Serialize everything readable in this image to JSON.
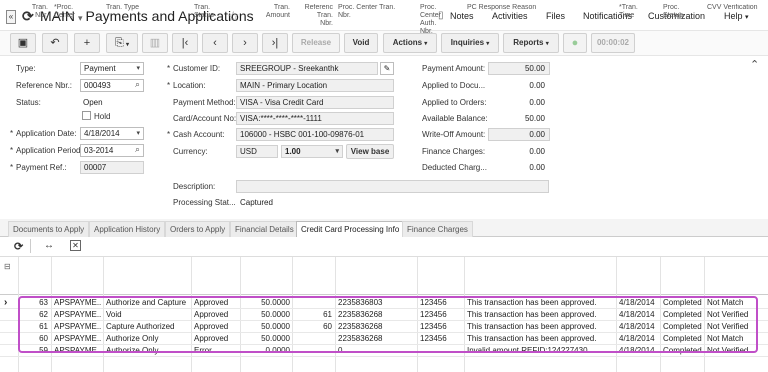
{
  "title": {
    "collapse": "«",
    "company": "MAIN",
    "sep": "▾",
    "screen": "Payments and Applications",
    "star": "☆"
  },
  "top_links": [
    "Notes",
    "Activities",
    "Files",
    "Notifications",
    "Customization",
    "Help"
  ],
  "toolbar": {
    "release": "Release",
    "void": "Void",
    "actions": "Actions",
    "inquiries": "Inquiries",
    "reports": "Reports",
    "timer": "00:00:02"
  },
  "form": {
    "type_label": "Type:",
    "type_value": "Payment",
    "refnbr_label": "Reference Nbr.:",
    "refnbr_value": "000493",
    "status_label": "Status:",
    "status_value": "Open",
    "hold_label": "Hold",
    "appdate_label": "Application Date:",
    "appdate_value": "4/18/2014",
    "appperiod_label": "Application Period:",
    "appperiod_value": "03-2014",
    "payref_label": "Payment Ref.:",
    "payref_value": "00007",
    "customer_label": "Customer ID:",
    "customer_value": "SREEGROUP - Sreekanthk",
    "location_label": "Location:",
    "location_value": "MAIN - Primary Location",
    "paymethod_label": "Payment Method:",
    "paymethod_value": "VISA - Visa Credit Card",
    "cardacct_label": "Card/Account No:",
    "cardacct_value": "VISA:****-****-****-1111",
    "cashacct_label": "Cash Account:",
    "cashacct_value": "106000 - HSBC 001-100-09876-01",
    "currency_label": "Currency:",
    "currency_value": "USD",
    "rate_value": "1.00",
    "viewbase": "View base",
    "description_label": "Description:",
    "description_value": "",
    "procstat_label": "Processing Stat...",
    "procstat_value": "Captured",
    "payamt_label": "Payment Amount:",
    "payamt_value": "50.00",
    "appdoc_label": "Applied to Docu...",
    "appdoc_value": "0.00",
    "apporders_label": "Applied to Orders:",
    "apporders_value": "0.00",
    "availbal_label": "Available Balance:",
    "availbal_value": "50.00",
    "writeoff_label": "Write-Off Amount:",
    "writeoff_value": "0.00",
    "fincharges_label": "Finance Charges:",
    "fincharges_value": "0.00",
    "deducted_label": "Deducted Charg...",
    "deducted_value": "0.00"
  },
  "tabs": [
    "Documents to Apply",
    "Application History",
    "Orders to Apply",
    "Financial Details",
    "Credit Card Processing Info",
    "Finance Charges"
  ],
  "active_tab": 4,
  "grid": {
    "headers": {
      "tran_nbr": "Tran.\nNbr.",
      "proc_center": "*Proc.\nCenter",
      "tran_type": "Tran. Type",
      "tran_status": "Tran.\nStatus",
      "tran_amount": "Tran.\nAmount",
      "ref_tran_nbr": "Referenc\nTran.\nNbr.",
      "proc_center_tran_nbr": "Proc. Center Tran.\nNbr.",
      "proc_center_auth_nbr": "Proc.\nCenter\nAuth.\nNbr.",
      "pc_response": "PC Response Reason",
      "tran_time": "*Tran.\nTime",
      "proc_status": "Proc.\nStatus",
      "cvv": "CVV Verification"
    },
    "rows": [
      {
        "sel": "›",
        "nbr": "63",
        "center": "APSPAYME...",
        "type": "Authorize and Capture",
        "status": "Approved",
        "amount": "50.0000",
        "ref": "",
        "pctran": "2235836803",
        "auth": "123456",
        "response": "This transaction has been approved.",
        "time": "4/18/2014",
        "pstatus": "Completed",
        "cvv": "Not Match"
      },
      {
        "sel": "",
        "nbr": "62",
        "center": "APSPAYME...",
        "type": "Void",
        "status": "Approved",
        "amount": "50.0000",
        "ref": "61",
        "pctran": "2235836268",
        "auth": "123456",
        "response": "This transaction has been approved.",
        "time": "4/18/2014",
        "pstatus": "Completed",
        "cvv": "Not Verified"
      },
      {
        "sel": "",
        "nbr": "61",
        "center": "APSPAYME...",
        "type": "Capture Authorized",
        "status": "Approved",
        "amount": "50.0000",
        "ref": "60",
        "pctran": "2235836268",
        "auth": "123456",
        "response": "This transaction has been approved.",
        "time": "4/18/2014",
        "pstatus": "Completed",
        "cvv": "Not Verified"
      },
      {
        "sel": "",
        "nbr": "60",
        "center": "APSPAYME...",
        "type": "Authorize Only",
        "status": "Approved",
        "amount": "50.0000",
        "ref": "",
        "pctran": "2235836268",
        "auth": "123456",
        "response": "This transaction has been approved.",
        "time": "4/18/2014",
        "pstatus": "Completed",
        "cvv": "Not Match"
      },
      {
        "sel": "",
        "nbr": "59",
        "center": "APSPAYME...",
        "type": "Authorize Only",
        "status": "Error",
        "amount": "0.0000",
        "ref": "",
        "pctran": "0",
        "auth": "",
        "response": "Invalid amount REFID:124227430",
        "time": "4/18/2014",
        "pstatus": "Completed",
        "cvv": "Not Verified"
      }
    ]
  }
}
